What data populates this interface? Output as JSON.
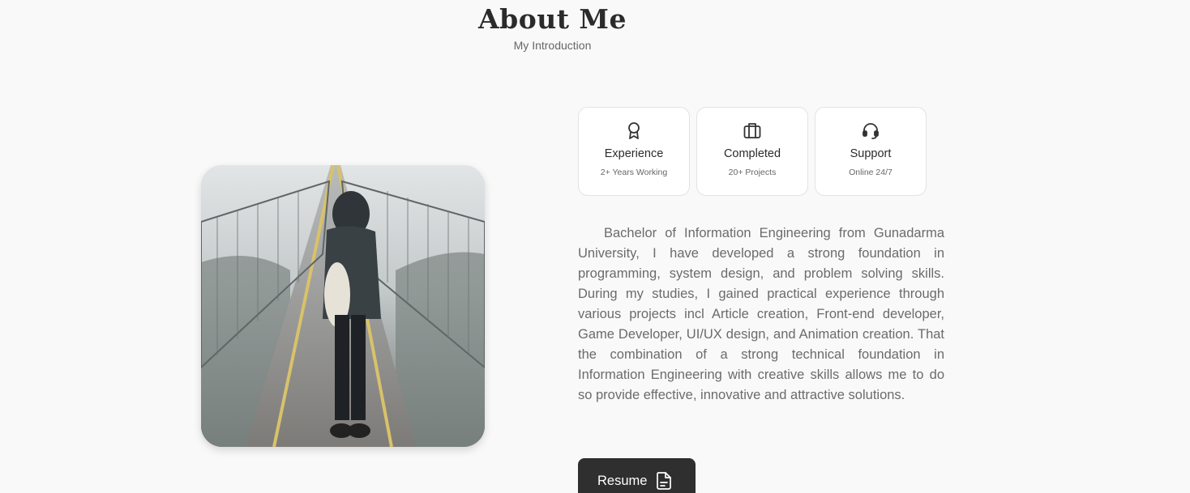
{
  "header": {
    "title": "About Me",
    "subtitle": "My Introduction"
  },
  "photo": {
    "icon": "person-on-bridge-photo"
  },
  "cards": [
    {
      "icon": "award-icon",
      "title": "Experience",
      "subtitle": "2+ Years Working"
    },
    {
      "icon": "briefcase-icon",
      "title": "Completed",
      "subtitle": "20+ Projects"
    },
    {
      "icon": "headset-icon",
      "title": "Support",
      "subtitle": "Online 24/7"
    }
  ],
  "description": "Bachelor of Information Engineering from Gunadarma University, I have developed a strong foundation in programming, system design, and problem solving skills. During my studies, I gained practical experience through various projects incl Article creation, Front-end developer, Game Developer, UI/UX design, and Animation creation. That the combination of a strong technical foundation in Information Engineering with creative skills allows me to do so provide effective, innovative and attractive solutions.",
  "resume_button": {
    "label": "Resume",
    "icon": "document-icon"
  },
  "colors": {
    "background": "#f9f9f9",
    "button": "#2f2f2f",
    "card_border": "#e3e3e3"
  }
}
